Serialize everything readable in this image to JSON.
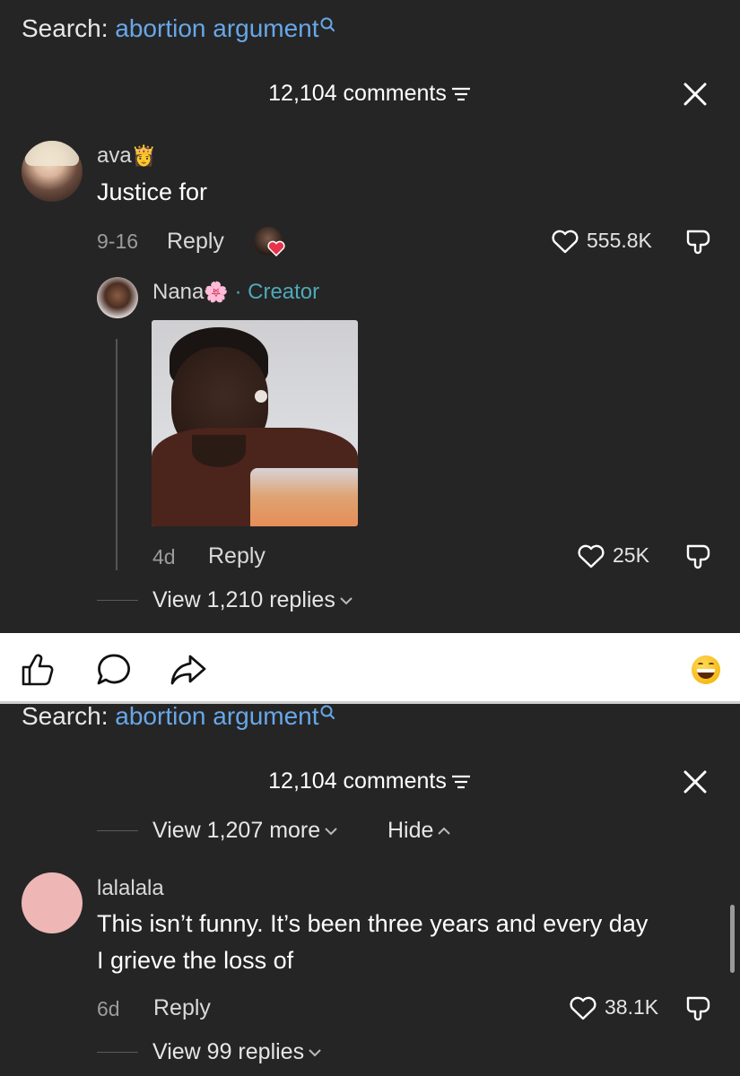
{
  "top": {
    "search_label": "Search:",
    "search_query": "abortion argument",
    "comment_count": "12,104 comments",
    "comment1": {
      "username": "ava",
      "username_emoji": "👸",
      "text": "Justice for",
      "date": "9-16",
      "reply": "Reply",
      "likes": "555.8K"
    },
    "reply1": {
      "username": "Nana",
      "username_emoji": "🌸",
      "creator_tag": "· Creator",
      "date": "4d",
      "reply": "Reply",
      "likes": "25K"
    },
    "view_replies": "View 1,210 replies"
  },
  "action_bar": {
    "icons": [
      "thumbs-up-icon",
      "comment-bubble-icon",
      "share-arrow-icon",
      "grin-emoji-icon"
    ]
  },
  "bottom": {
    "search_label": "Search:",
    "search_query": "abortion argument",
    "comment_count": "12,104 comments",
    "view_more": "View 1,207 more",
    "hide": "Hide",
    "comment2": {
      "username": "lalalala",
      "text_line1": "This isn’t funny. It’s been three years and every day",
      "text_line2": "I grieve the loss of",
      "date": "6d",
      "reply": "Reply",
      "likes": "38.1K"
    },
    "view_replies": "View 99 replies"
  },
  "colors": {
    "background": "#252525",
    "search_blue": "#68a7e8",
    "creator_teal": "#4fa9b8",
    "white_bar": "#ffffff"
  }
}
